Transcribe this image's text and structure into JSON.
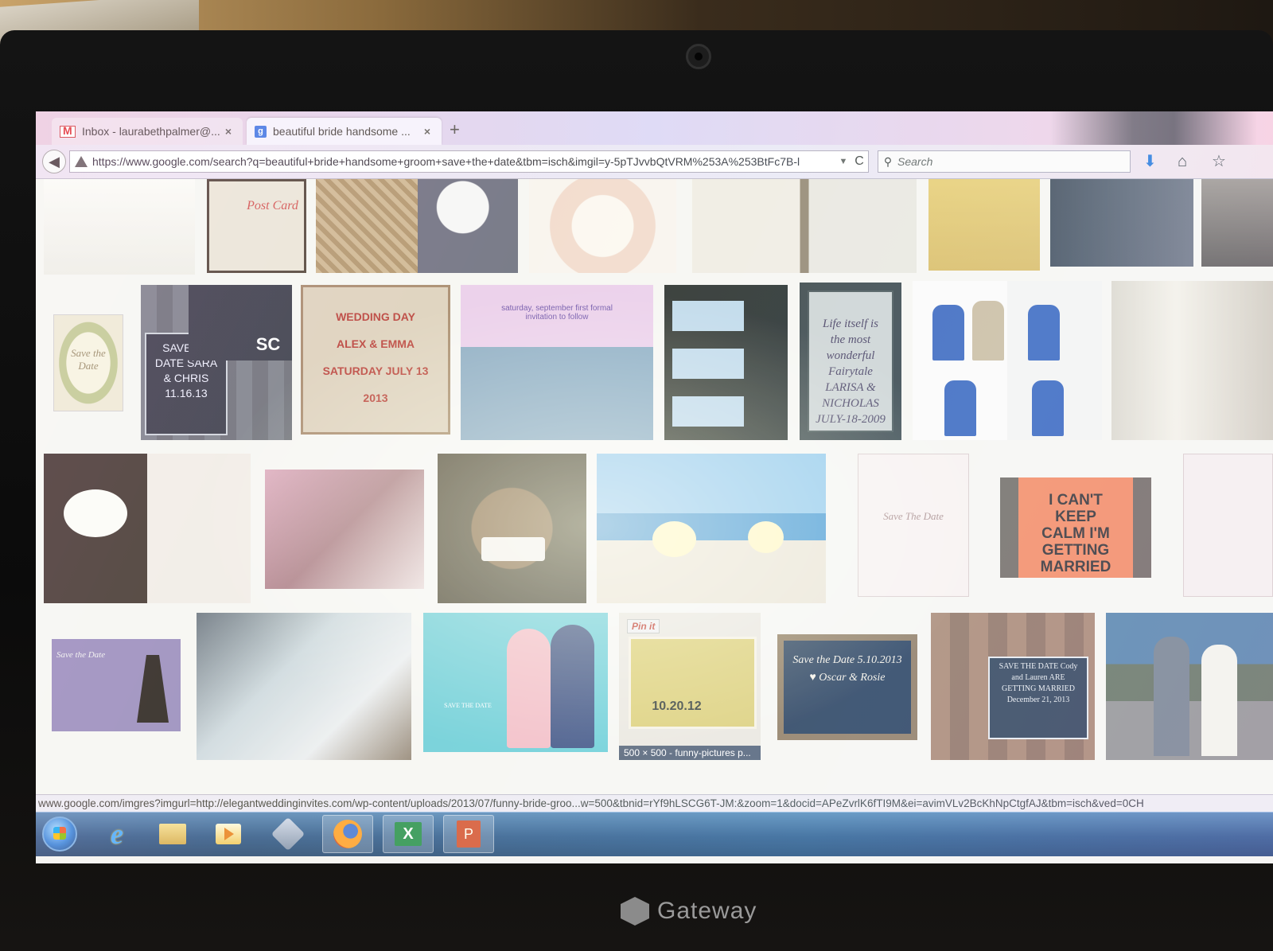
{
  "browser": {
    "tabs": [
      {
        "label": "Inbox - laurabethpalmer@...",
        "icon": "gmail-icon"
      },
      {
        "label": "beautiful bride handsome ...",
        "icon": "google-icon"
      }
    ],
    "new_tab_label": "+",
    "close_glyph": "×",
    "url": "https://www.google.com/search?q=beautiful+bride+handsome+groom+save+the+date&tbm=isch&imgil=y-5pTJvvbQtVRM%253A%253BtFc7B-l",
    "search_placeholder": "Search",
    "back_glyph": "◀",
    "reload_glyph": "C",
    "icons": [
      "back-icon",
      "warning-icon",
      "dropdown-icon",
      "reload-icon",
      "search-icon",
      "download-icon",
      "home-icon",
      "star-icon"
    ]
  },
  "results": {
    "thumbs": [
      {
        "text": ""
      },
      {
        "text": "Post Card"
      },
      {
        "text": ""
      },
      {
        "text": ""
      },
      {
        "text": ""
      },
      {
        "text": ""
      },
      {
        "text": ""
      },
      {
        "text": ""
      },
      {
        "text": ""
      },
      {
        "text": "Save the Date"
      },
      {
        "text": "SAVE the DATE SARA & CHRIS 11.16.13"
      },
      {
        "text": "SC"
      },
      {
        "text": "WEDDING DAY ALEX & EMMA SATURDAY JULY 13 2013"
      },
      {
        "text": "saturday, september first formal invitation to follow"
      },
      {
        "text": ""
      },
      {
        "text": "Life itself is the most wonderful Fairytale LARISA & NICHOLAS JULY-18-2009"
      },
      {
        "text": ""
      },
      {
        "text": ""
      },
      {
        "text": ""
      },
      {
        "text": ""
      },
      {
        "text": ""
      },
      {
        "text": ""
      },
      {
        "text": "Save The Date"
      },
      {
        "text": "I CAN'T KEEP CALM I'M GETTING MARRIED"
      },
      {
        "text": ""
      },
      {
        "text": "Save the Date"
      },
      {
        "text": ""
      },
      {
        "text": "SAVE THE DATE"
      },
      {
        "text": "10.20.12"
      },
      {
        "text": "Save the Date 5.10.2013 ♥ Oscar & Rosie"
      },
      {
        "text": "SAVE THE DATE Cody and Lauren ARE GETTING MARRIED December 21, 2013"
      },
      {
        "text": ""
      }
    ],
    "pin_label": "Pin it",
    "hover_caption": "500 × 500 - funny-pictures p..."
  },
  "status_url": "www.google.com/imgres?imgurl=http://elegantweddinginvites.com/wp-content/uploads/2013/07/funny-bride-groo...w=500&tbnid=rYf9hLSCG6T-JM:&zoom=1&docid=APeZvrlK6fTI9M&ei=avimVLv2BcKhNpCtgfAJ&tbm=isch&ved=0CH",
  "taskbar": {
    "items": [
      "start-orb",
      "internet-explorer-icon",
      "folder-icon",
      "media-player-icon",
      "tool-icon",
      "firefox-icon",
      "excel-icon",
      "powerpoint-icon"
    ],
    "excel_letter": "X",
    "ppt_letter": "P"
  },
  "laptop": {
    "brand": "Gateway"
  }
}
